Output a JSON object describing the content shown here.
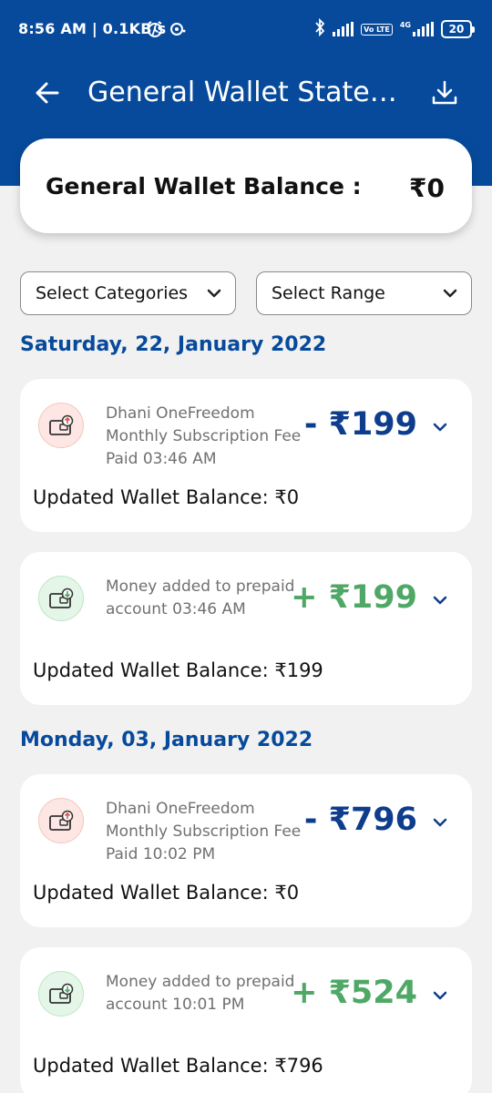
{
  "status_bar": {
    "time_speed": "8:56 AM | 0.1KB/s",
    "volte_badge": "Vo LTE",
    "network_4g": "4G",
    "battery": "20"
  },
  "app_bar": {
    "title": "General Wallet Statement"
  },
  "balance": {
    "label": "General Wallet Balance :",
    "value": "₹0"
  },
  "filters": {
    "categories": "Select Categories",
    "range": "Select Range"
  },
  "groups": [
    {
      "date": "Saturday, 22, January 2022",
      "transactions": [
        {
          "type": "debit",
          "line1": "Dhani OneFreedom",
          "line2": "Monthly Subscription Fee",
          "line3": "Paid 03:46 AM",
          "amount": "- ₹199",
          "updated": "Updated Wallet Balance: ₹0"
        },
        {
          "type": "credit",
          "line1": "Money added to prepaid",
          "line2": "account 03:46 AM",
          "line3": "",
          "amount": "+ ₹199",
          "updated": "Updated Wallet Balance: ₹199"
        }
      ]
    },
    {
      "date": "Monday, 03, January 2022",
      "transactions": [
        {
          "type": "debit",
          "line1": "Dhani OneFreedom",
          "line2": "Monthly Subscription Fee",
          "line3": "Paid 10:02 PM",
          "amount": "- ₹796",
          "updated": "Updated Wallet Balance: ₹0"
        },
        {
          "type": "credit",
          "line1": "Money added to prepaid",
          "line2": "account 10:01 PM",
          "line3": "",
          "amount": "+ ₹524",
          "updated": "Updated Wallet Balance: ₹796"
        }
      ]
    }
  ],
  "colors": {
    "brand_blue": "#074a9b",
    "debit_amount": "#0d3d8c",
    "credit_amount": "#4fa866",
    "background": "#f1f1f1"
  },
  "icons": {
    "back": "arrow-left-icon",
    "download": "download-icon",
    "chevron": "chevron-down-icon",
    "wallet": "wallet-icon"
  }
}
